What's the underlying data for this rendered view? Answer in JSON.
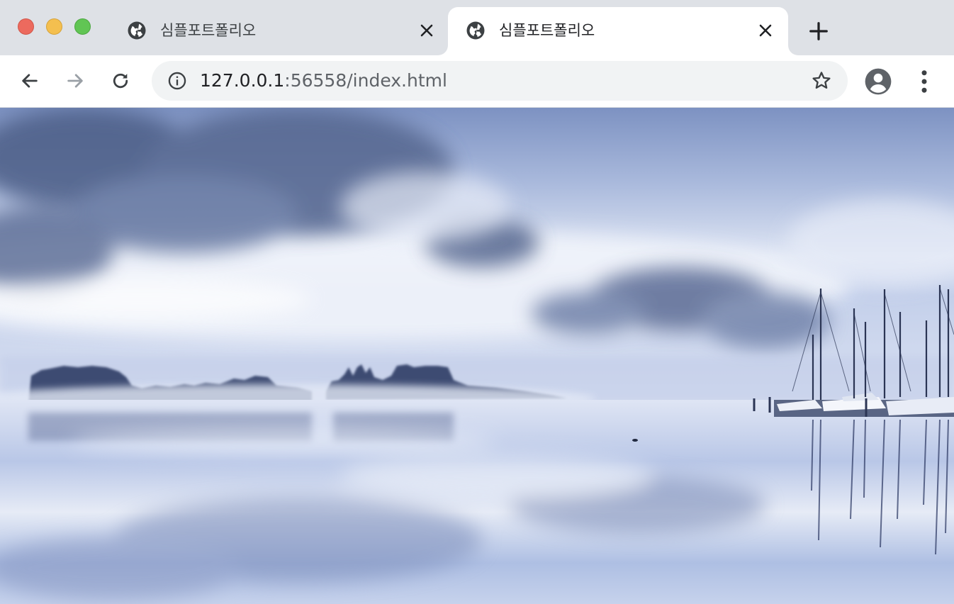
{
  "window": {
    "traffic_lights": [
      "close",
      "minimize",
      "maximize"
    ]
  },
  "tabs": [
    {
      "title": "심플포트폴리오",
      "favicon": "globe-icon",
      "active": false
    },
    {
      "title": "심플포트폴리오",
      "favicon": "globe-icon",
      "active": true
    }
  ],
  "toolbar": {
    "url_host": "127.0.0.1",
    "url_rest": ":56558/index.html"
  },
  "content": {
    "hero_image": "misty lake with sailboats at dawn",
    "colors": {
      "sky_top": "#6f86b8",
      "mist": "#eef1f9",
      "water": "#b7c5e6"
    }
  },
  "colors": {
    "tabstrip_bg": "#dee1e6",
    "toolbar_bg": "#ffffff",
    "omnibox_bg": "#f1f3f4",
    "icon": "#5f6368"
  }
}
